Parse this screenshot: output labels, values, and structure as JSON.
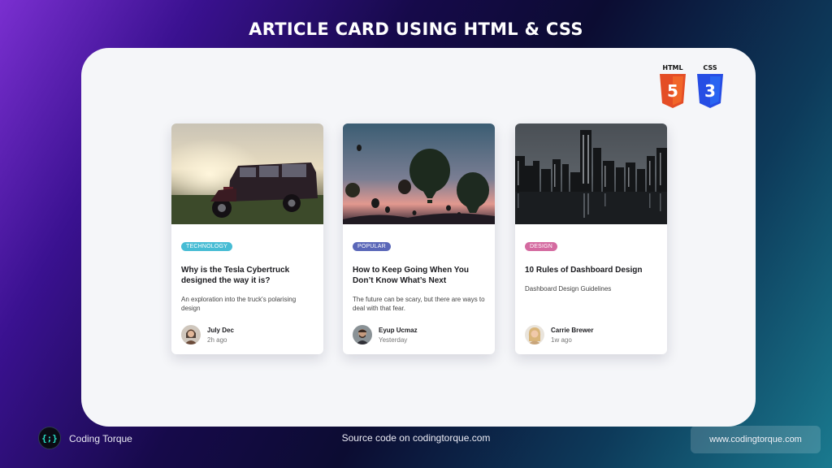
{
  "header": {
    "title": "ARTICLE CARD USING HTML & CSS"
  },
  "badges": [
    {
      "label": "HTML",
      "digit": "5",
      "color": "#e44d26",
      "icon": "html5-icon"
    },
    {
      "label": "CSS",
      "digit": "3",
      "color": "#264de4",
      "icon": "css3-icon"
    }
  ],
  "cards": [
    {
      "tag": "TECHNOLOGY",
      "tag_color": "#47bcd4",
      "title": "Why is the Tesla Cybertruck designed the way it is?",
      "description": "An exploration into the truck's polarising design",
      "author": {
        "name": "July Dec",
        "time": "2h ago"
      },
      "image": "vintage-jeep-photo"
    },
    {
      "tag": "POPULAR",
      "tag_color": "#5a67b8",
      "title": "How to Keep Going When You Don’t Know What’s Next",
      "description": "The future can be scary, but there are ways to deal with that fear.",
      "author": {
        "name": "Eyup Ucmaz",
        "time": "Yesterday"
      },
      "image": "hot-air-balloons-photo"
    },
    {
      "tag": "DESIGN",
      "tag_color": "#d46aa0",
      "title": "10 Rules of Dashboard Design",
      "description": "Dashboard Design Guidelines",
      "author": {
        "name": "Carrie Brewer",
        "time": "1w ago"
      },
      "image": "city-skyline-photo"
    }
  ],
  "footer": {
    "logo_text": "{;}",
    "brand": "Coding Torque",
    "source": "Source code on codingtorque.com",
    "url": "www.codingtorque.com"
  }
}
